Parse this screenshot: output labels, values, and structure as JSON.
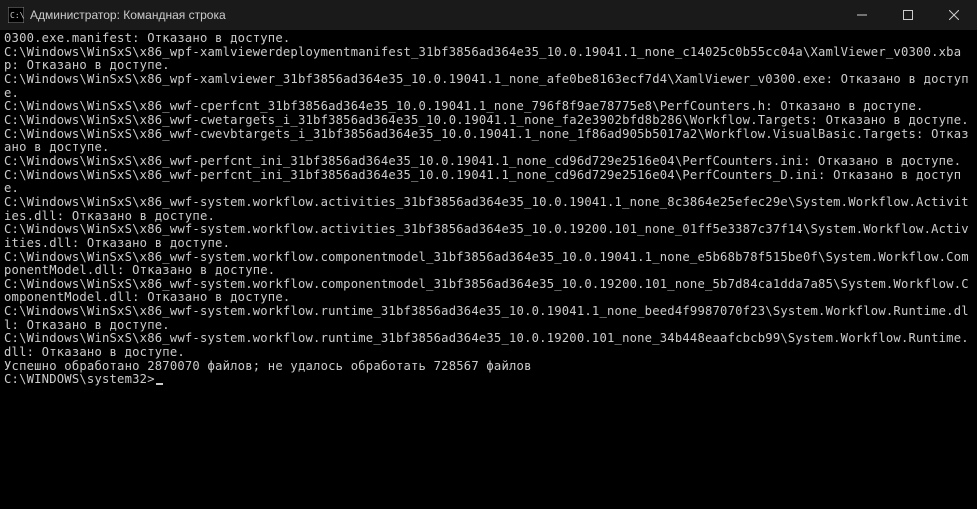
{
  "titlebar": {
    "title": "Администратор: Командная строка"
  },
  "terminal": {
    "lines": [
      "0300.exe.manifest: Отказано в доступе.",
      "C:\\Windows\\WinSxS\\x86_wpf-xamlviewerdeploymentmanifest_31bf3856ad364e35_10.0.19041.1_none_c14025c0b55cc04a\\XamlViewer_v0300.xbap: Отказано в доступе.",
      "C:\\Windows\\WinSxS\\x86_wpf-xamlviewer_31bf3856ad364e35_10.0.19041.1_none_afe0be8163ecf7d4\\XamlViewer_v0300.exe: Отказано в доступе.",
      "C:\\Windows\\WinSxS\\x86_wwf-cperfcnt_31bf3856ad364e35_10.0.19041.1_none_796f8f9ae78775e8\\PerfCounters.h: Отказано в доступе.",
      "C:\\Windows\\WinSxS\\x86_wwf-cwetargets_i_31bf3856ad364e35_10.0.19041.1_none_fa2e3902bfd8b286\\Workflow.Targets: Отказано в доступе.",
      "C:\\Windows\\WinSxS\\x86_wwf-cwevbtargets_i_31bf3856ad364e35_10.0.19041.1_none_1f86ad905b5017a2\\Workflow.VisualBasic.Targets: Отказано в доступе.",
      "C:\\Windows\\WinSxS\\x86_wwf-perfcnt_ini_31bf3856ad364e35_10.0.19041.1_none_cd96d729e2516e04\\PerfCounters.ini: Отказано в доступе.",
      "C:\\Windows\\WinSxS\\x86_wwf-perfcnt_ini_31bf3856ad364e35_10.0.19041.1_none_cd96d729e2516e04\\PerfCounters_D.ini: Отказано в доступе.",
      "C:\\Windows\\WinSxS\\x86_wwf-system.workflow.activities_31bf3856ad364e35_10.0.19041.1_none_8c3864e25efec29e\\System.Workflow.Activities.dll: Отказано в доступе.",
      "C:\\Windows\\WinSxS\\x86_wwf-system.workflow.activities_31bf3856ad364e35_10.0.19200.101_none_01ff5e3387c37f14\\System.Workflow.Activities.dll: Отказано в доступе.",
      "C:\\Windows\\WinSxS\\x86_wwf-system.workflow.componentmodel_31bf3856ad364e35_10.0.19041.1_none_e5b68b78f515be0f\\System.Workflow.ComponentModel.dll: Отказано в доступе.",
      "C:\\Windows\\WinSxS\\x86_wwf-system.workflow.componentmodel_31bf3856ad364e35_10.0.19200.101_none_5b7d84ca1dda7a85\\System.Workflow.ComponentModel.dll: Отказано в доступе.",
      "C:\\Windows\\WinSxS\\x86_wwf-system.workflow.runtime_31bf3856ad364e35_10.0.19041.1_none_beed4f9987070f23\\System.Workflow.Runtime.dll: Отказано в доступе.",
      "C:\\Windows\\WinSxS\\x86_wwf-system.workflow.runtime_31bf3856ad364e35_10.0.19200.101_none_34b448eaafcbcb99\\System.Workflow.Runtime.dll: Отказано в доступе.",
      "Успешно обработано 2870070 файлов; не удалось обработать 728567 файлов",
      ""
    ],
    "prompt": "C:\\WINDOWS\\system32>"
  }
}
